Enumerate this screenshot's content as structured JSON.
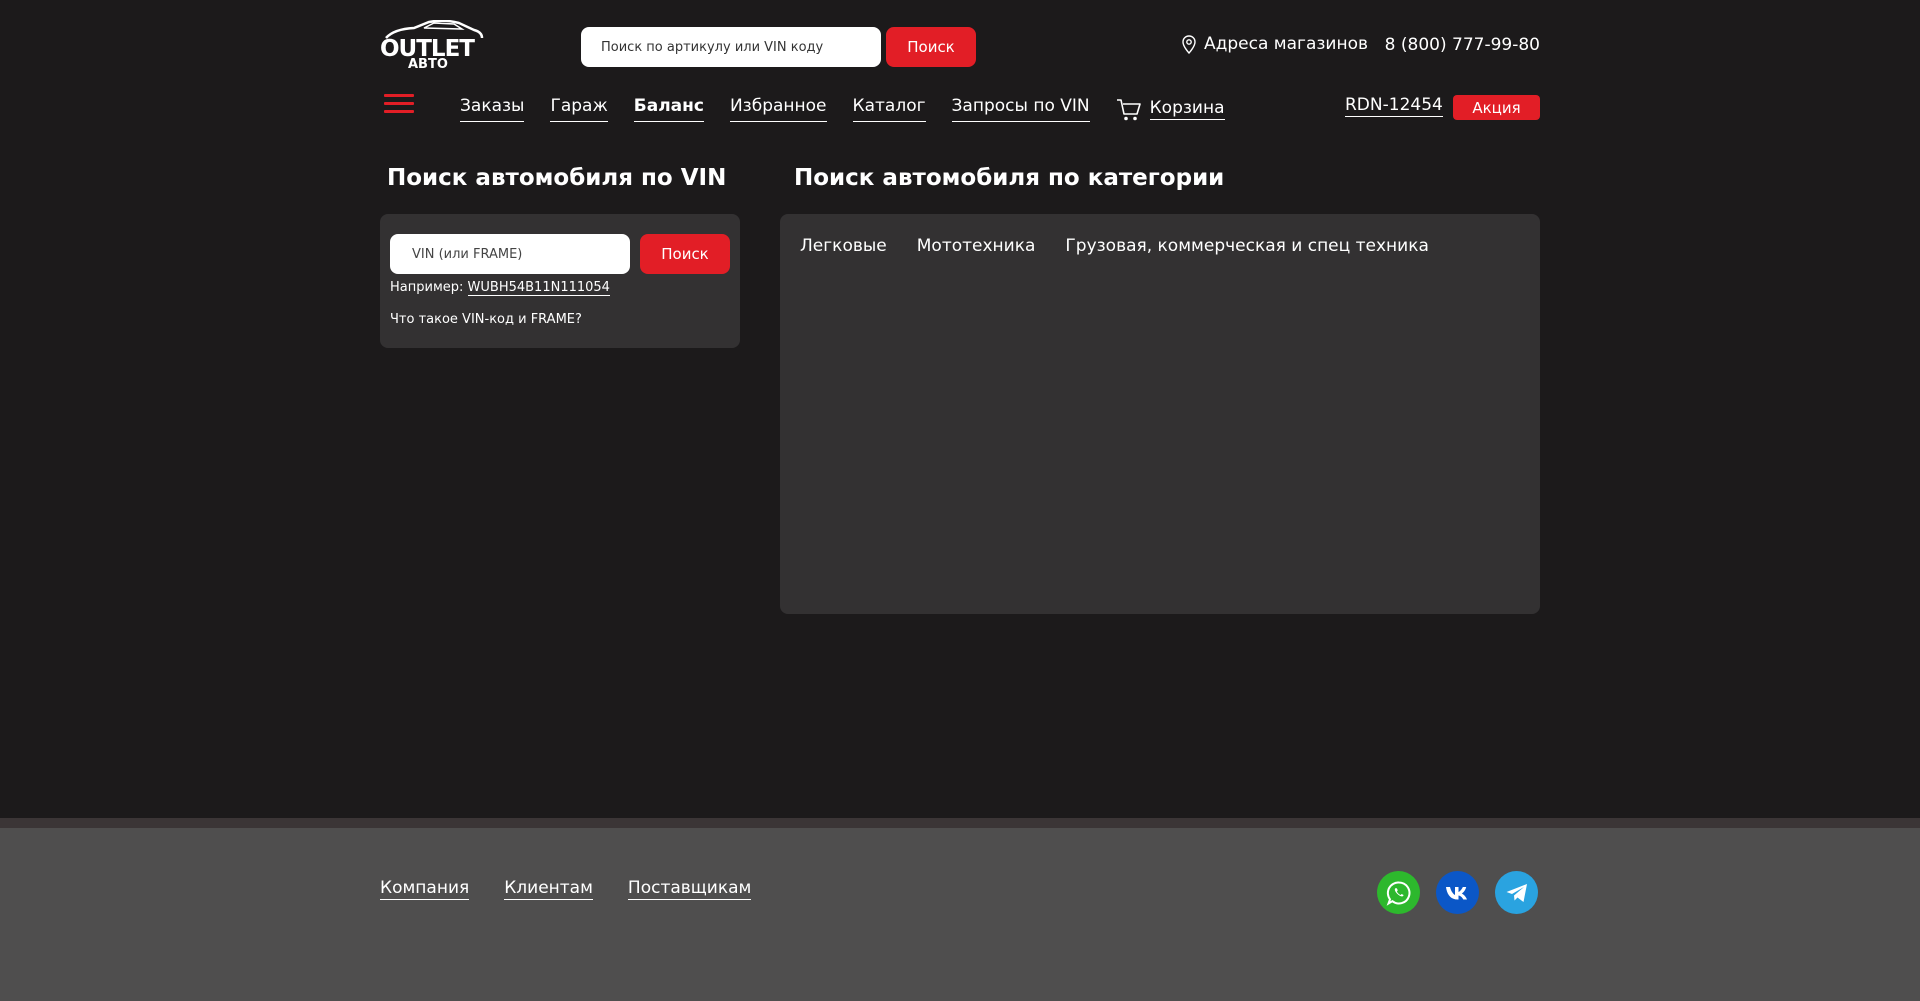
{
  "header": {
    "logo_top": "OUTLET",
    "logo_bottom": "АВТО",
    "search_placeholder": "Поиск по артикулу или VIN коду",
    "search_button": "Поиск",
    "addresses": "Адреса магазинов",
    "phone": "8 (800) 777-99-80"
  },
  "nav": {
    "items": [
      "Заказы",
      "Гараж",
      "Баланс",
      "Избранное",
      "Каталог",
      "Запросы по VIN"
    ],
    "cart": "Корзина",
    "active": "Баланс",
    "user_id": "RDN-12454",
    "promo": "Акция"
  },
  "vin": {
    "title": "Поиск автомобиля по VIN",
    "placeholder": "VIN (или FRAME)",
    "button": "Поиск",
    "example_label": "Например:",
    "example_value": "WUBH54B11N111054",
    "help": "Что такое VIN-код и FRAME?"
  },
  "category": {
    "title": "Поиск автомобиля по категории",
    "tabs": [
      "Легковые",
      "Мототехника",
      "Грузовая, коммерческая и спец техника"
    ]
  },
  "footer": {
    "links": [
      "Компания",
      "Клиентам",
      "Поставщикам"
    ],
    "socials": [
      {
        "icon": "whatsapp-icon",
        "color": "#2db82d"
      },
      {
        "icon": "vk-icon",
        "color": "#0b57c7"
      },
      {
        "icon": "telegram-icon",
        "color": "#2aa3e0"
      }
    ]
  },
  "colors": {
    "accent": "#e21e26",
    "background": "#1c1a1b",
    "panel": "#333132",
    "footer": "#4f4e4e"
  }
}
